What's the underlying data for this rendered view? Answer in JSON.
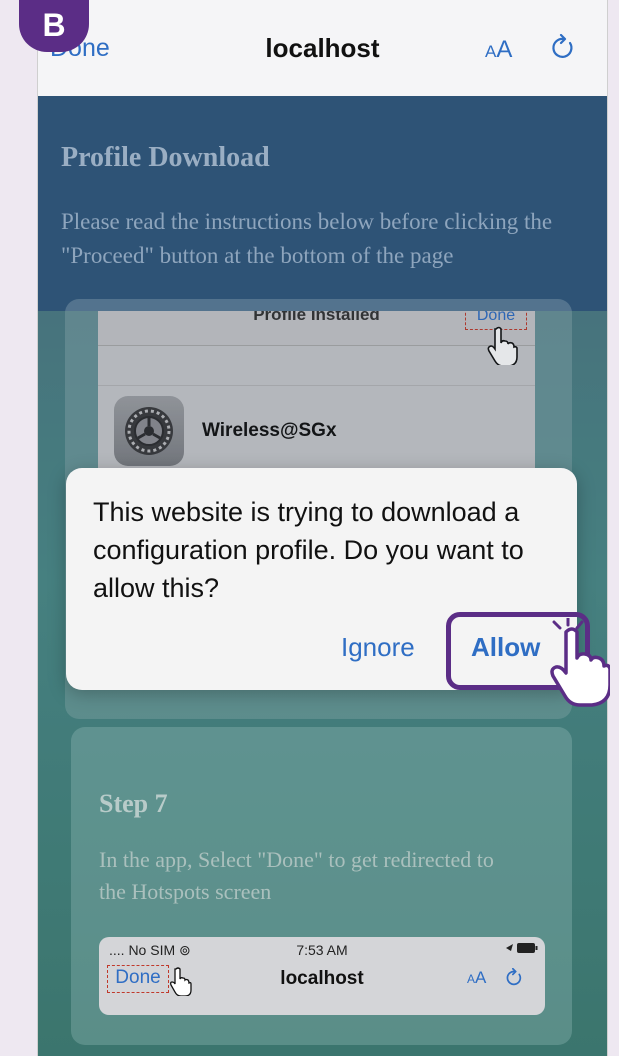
{
  "badge": "B",
  "navbar": {
    "done_label": "Done",
    "title": "localhost",
    "aa_small": "A",
    "aa_big": "A"
  },
  "header": {
    "title": "Profile Download",
    "text": "Please read the instructions below before clicking the \"Proceed\" button at the bottom of the page"
  },
  "step6_screenshot": {
    "top_label": "Profile Installed",
    "done_label": "Done",
    "row_label": "Wireless@SGx"
  },
  "dialog": {
    "message": "This website is trying to download a configuration profile. Do you want to allow this?",
    "ignore_label": "Ignore",
    "allow_label": "Allow"
  },
  "step7": {
    "title": "Step 7",
    "text": "In the app, Select \"Done\" to get redirected to the Hotspots screen",
    "screenshot": {
      "status_left": ".... No SIM",
      "time": "7:53 AM",
      "done_label": "Done",
      "title": "localhost",
      "aa_small": "A",
      "aa_big": "A"
    }
  },
  "colors": {
    "accent": "#2f6ec4",
    "highlight": "#5b2d86",
    "header_bg": "#2e5376"
  },
  "icons": [
    "reload-icon",
    "settings-icon",
    "pointer-hand-icon",
    "location-arrow-icon",
    "battery-icon"
  ]
}
